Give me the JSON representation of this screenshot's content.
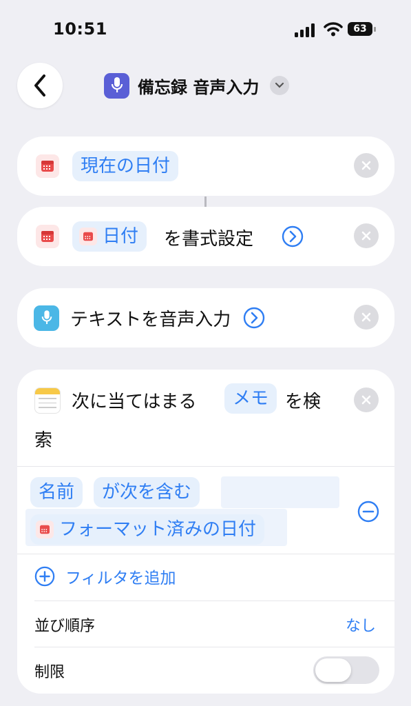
{
  "status_bar": {
    "time": "10:51",
    "battery": "63"
  },
  "nav": {
    "title": "備忘録 音声入力"
  },
  "actions": {
    "current_date": {
      "token": "現在の日付"
    },
    "format_date": {
      "token": "日付",
      "suffix": "を書式設定"
    },
    "dictate": {
      "label": "テキストを音声入力"
    },
    "find_notes": {
      "prefix": "次に当てはまる",
      "token": "メモ",
      "suffix_1": "を検",
      "suffix_2": "索",
      "filter": {
        "field": "名前",
        "operator": "が次を含む",
        "value_token": "フォーマット済みの日付"
      },
      "add_filter": "フィルタを追加",
      "sort_label": "並び順序",
      "sort_value": "なし",
      "limit_label": "制限",
      "limit_enabled": false
    }
  },
  "colors": {
    "accent": "#2f7ef3",
    "background": "#efeff4",
    "shortcut_icon": "#5a5fd6"
  }
}
